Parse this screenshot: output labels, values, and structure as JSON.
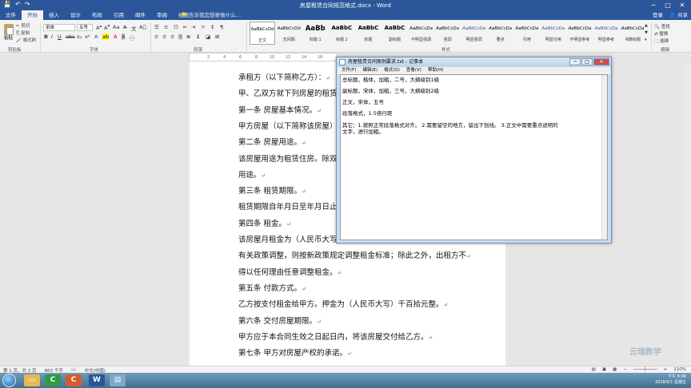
{
  "window": {
    "title": "房屋租赁合同规范格式.docx - Word",
    "min": "─",
    "max": "□",
    "close": "✕"
  },
  "tabs": {
    "items": [
      "文件",
      "开始",
      "插入",
      "设计",
      "布局",
      "引用",
      "邮件",
      "审阅",
      "视图"
    ],
    "tell_me": "告诉我您想要做什么…",
    "login": "登录",
    "share": "共享"
  },
  "ribbon": {
    "clipboard": {
      "paste": "粘贴",
      "cut": "剪切",
      "copy": "复制",
      "format_painter": "格式刷",
      "label": "剪贴板"
    },
    "font": {
      "family": "宋体",
      "size": "五号",
      "label": "字体"
    },
    "paragraph": {
      "label": "段落"
    },
    "styles": {
      "label": "样式",
      "items": [
        {
          "sample": "AaBbCcDd",
          "name": "正文"
        },
        {
          "sample": "AaBbCcDd",
          "name": "无间隔"
        },
        {
          "sample": "AaBb",
          "name": "标题 1"
        },
        {
          "sample": "AaBbC",
          "name": "标题 2"
        },
        {
          "sample": "AaBbC",
          "name": "标题"
        },
        {
          "sample": "AaBbC",
          "name": "副标题"
        },
        {
          "sample": "AaBbCcDa",
          "name": "不明显强调"
        },
        {
          "sample": "AaBbCcDa",
          "name": "强调"
        },
        {
          "sample": "AaBbCcDa",
          "name": "明显强调"
        },
        {
          "sample": "AaBbCcDa",
          "name": "要点"
        },
        {
          "sample": "AaBbCcDa",
          "name": "引用"
        },
        {
          "sample": "AaBbCcDa",
          "name": "明显引用"
        },
        {
          "sample": "AaBbCcDa",
          "name": "不明显参考"
        },
        {
          "sample": "AaBbCcDa",
          "name": "明显参考"
        },
        {
          "sample": "AaBbCcDa",
          "name": "书籍标题"
        }
      ]
    },
    "editing": {
      "find": "查找",
      "replace": "替换",
      "select": "选择",
      "label": "编辑"
    }
  },
  "ruler": {
    "ticks": [
      "2",
      "4",
      "6",
      "8",
      "10",
      "12",
      "14",
      "16"
    ]
  },
  "document": {
    "lines": [
      "承租方（以下简称乙方）：",
      "甲、乙双方就下列房屋的租赁达成如下协议：",
      "第一条  房屋基本情况。",
      "甲方房屋（以下简称该房屋）坐落于",
      "第二条  房屋用途。",
      "该房屋用途为租赁住房。除双方另有约定外，乙方不得任意改变房屋",
      "用途。",
      "第三条  租赁期限。",
      "租赁期限自年月日至年月日止。",
      "第四条  租金。",
      "该房屋月租金为（人民币大写）千百拾元整。租赁期间，如遇到国家",
      "有关政策调整，则按新政策规定调整租金标准；除此之外，出租方不",
      "得以任何理由任意调整租金。",
      "第五条  付款方式。",
      "乙方按支付租金给甲方。押金为（人民币大写）千百拾元整。",
      "第六条  交付房屋期限。",
      "甲方应于本合同生效之日起日内，将该房屋交付给乙方。",
      "第七条  甲方对房屋产权的承诺。"
    ],
    "mark": "↵"
  },
  "notepad": {
    "title": "房屋租赁合同案例要求.txt - 记事本",
    "menu": [
      "文件(F)",
      "编辑(E)",
      "格式(O)",
      "查看(V)",
      "帮助(H)"
    ],
    "lines": [
      "总标题，楷体，加粗，二号，大纲级别1级",
      "副标题，宋体，加粗，三号，大纲级别2级",
      "正文，宋体，五号",
      "段落格式，1.5倍行距",
      "其它：1.按照正常段落格式对齐。      2.需要留空的地方，留出下划线。       3.正文中需要重点说明的",
      "文字，进行加粗。"
    ]
  },
  "status": {
    "page": "第 1 页，共 3 页",
    "words": "863 个字",
    "lang": "中文(中国)",
    "zoom": "110%"
  },
  "tray": {
    "time": "下午 6:06",
    "date": "2018/6/1 星期五"
  },
  "watermark": "云瑞教学"
}
